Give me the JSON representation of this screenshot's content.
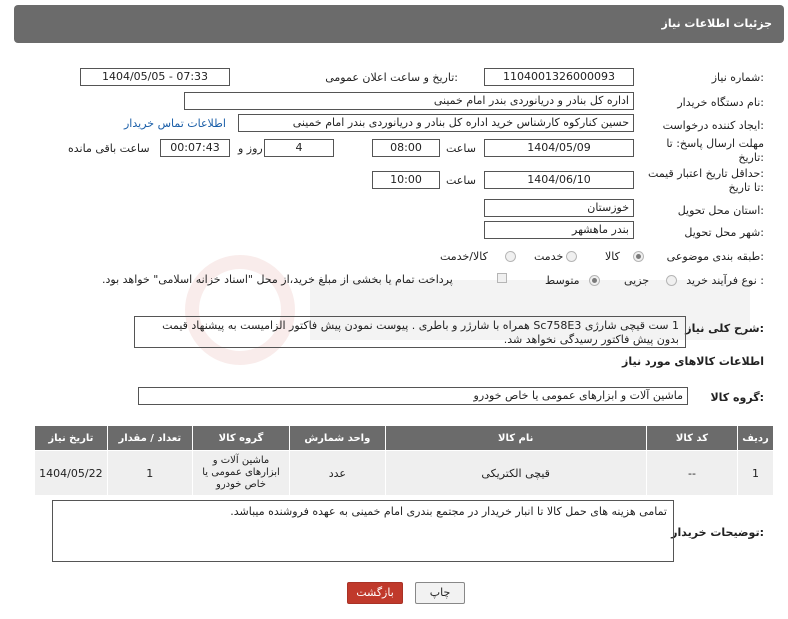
{
  "header": {
    "title": "جزئیات اطلاعات نیاز"
  },
  "fields": {
    "need_number_label": "شماره نیاز:",
    "need_number": "1104001326000093",
    "announce_label": "تاریخ و ساعت اعلان عمومی:",
    "announce_value": "1404/05/05 - 07:33",
    "buyer_org_label": "نام دستگاه خریدار:",
    "buyer_org": "اداره کل بنادر و دریانوردی بندر امام خمینی",
    "creator_label": "ایجاد کننده درخواست:",
    "creator": "حسین کنارکوه کارشناس خرید اداره کل بنادر و دریانوردی بندر امام خمینی",
    "contact_link": "اطلاعات تماس خریدار",
    "reply_deadline_label_1": "مهلت ارسال پاسخ: تا",
    "reply_deadline_label_2": "تاریخ:",
    "reply_date": "1404/05/09",
    "time_label": "ساعت",
    "reply_time": "08:00",
    "days_value": "4",
    "days_label": "روز و",
    "remaining_time": "00:07:43",
    "remaining_label": "ساعت باقی مانده",
    "validity_label_1": "حداقل تاریخ اعتبار قیمت:",
    "validity_label_2": "تا تاریخ:",
    "validity_date": "1404/06/10",
    "validity_time": "10:00",
    "province_label": "استان محل تحویل:",
    "province": "خوزستان",
    "city_label": "شهر محل تحویل:",
    "city": "بندر ماهشهر",
    "category_label": "طبقه بندی موضوعی:",
    "category_options": [
      "کالا",
      "خدمت",
      "کالا/خدمت"
    ],
    "category_selected": "کالا",
    "process_label": "نوع فرآیند خرید :",
    "process_options": [
      "جزیی",
      "متوسط"
    ],
    "process_selected": "متوسط",
    "payment_note": "پرداخت تمام یا بخشی از مبلغ خرید،از محل \"اسناد خزانه اسلامی\" خواهد بود.",
    "description_label": "شرح کلی نیاز:",
    "description": "1 ست قیچی شارژی Sc758E3  همراه با شارژر و باطری . پیوست نمودن پیش فاکتور الزامیست به پیشنهاد قیمت بدون پیش فاکتور رسیدگی نخواهد شد."
  },
  "goods": {
    "section_title": "اطلاعات کالاهای مورد نیاز",
    "group_label": "گروه کالا:",
    "group_value": "ماشین آلات و ابزارهای عمومی یا خاص خودرو",
    "columns": [
      "ردیف",
      "کد کالا",
      "نام کالا",
      "واحد شمارش",
      "گروه کالا",
      "تعداد / مقدار",
      "تاریخ نیاز"
    ],
    "rows": [
      [
        "1",
        "--",
        "قیچی الکتریکی",
        "عدد",
        "ماشین آلات و ابزارهای عمومی یا خاص خودرو",
        "1",
        "1404/05/22"
      ]
    ]
  },
  "buyer_notes": {
    "label": "توضیحات خریدار:",
    "text": "تمامی هزینه های حمل کالا تا انبار خریدار در مجتمع بندری امام خمینی به عهده فروشنده میباشد."
  },
  "buttons": {
    "print": "چاپ",
    "back": "بازگشت"
  },
  "colors": {
    "header_bg": "#6b6b6b",
    "back_button": "#c0392b",
    "link": "#1a5ea8"
  }
}
